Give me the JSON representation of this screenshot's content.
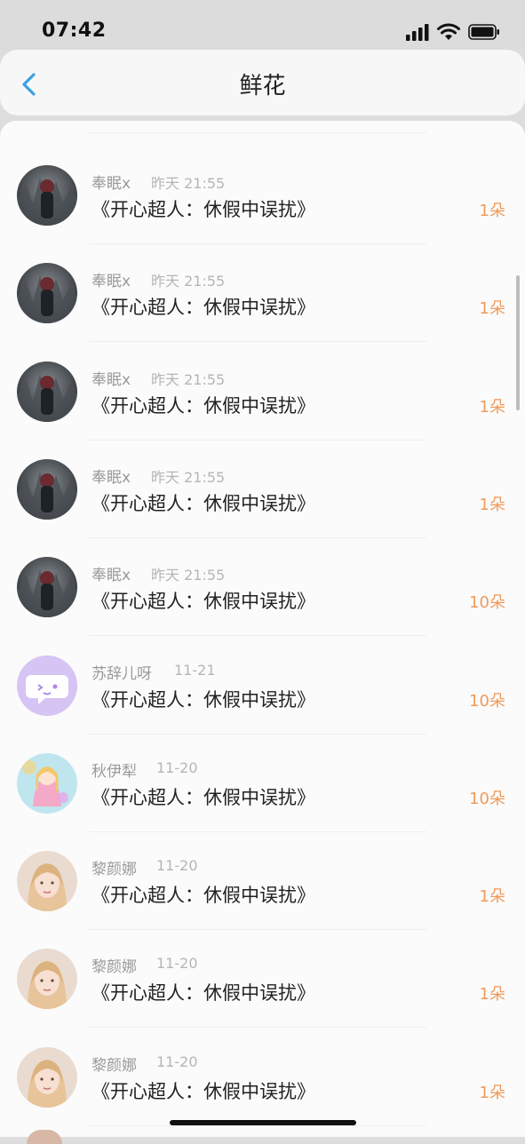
{
  "status": {
    "time": "07:42"
  },
  "header": {
    "title": "鲜花"
  },
  "icons": {
    "back": "chevron-left-icon",
    "signal": "signal-icon",
    "wifi": "wifi-icon",
    "battery": "battery-icon"
  },
  "colors": {
    "accent": "#3aa0e6",
    "count": "#f09a5a",
    "name": "#9a9a9a",
    "time": "#b5b5b5"
  },
  "items": [
    {
      "name": "奉眠x",
      "time": "昨天 21:55",
      "title": "《开心超人：休假中误扰》",
      "count": "1朵",
      "avatar": "dark-photo"
    },
    {
      "name": "奉眠x",
      "time": "昨天 21:55",
      "title": "《开心超人：休假中误扰》",
      "count": "1朵",
      "avatar": "dark-photo"
    },
    {
      "name": "奉眠x",
      "time": "昨天 21:55",
      "title": "《开心超人：休假中误扰》",
      "count": "1朵",
      "avatar": "dark-photo"
    },
    {
      "name": "奉眠x",
      "time": "昨天 21:55",
      "title": "《开心超人：休假中误扰》",
      "count": "1朵",
      "avatar": "dark-photo"
    },
    {
      "name": "奉眠x",
      "time": "昨天 21:55",
      "title": "《开心超人：休假中误扰》",
      "count": "10朵",
      "avatar": "dark-photo"
    },
    {
      "name": "苏辞儿呀",
      "time": "11-21",
      "title": "《开心超人：休假中误扰》",
      "count": "10朵",
      "avatar": "purple-chat"
    },
    {
      "name": "秋伊犁",
      "time": "11-20",
      "title": "《开心超人：休假中误扰》",
      "count": "10朵",
      "avatar": "anime-girl"
    },
    {
      "name": "黎颜娜",
      "time": "11-20",
      "title": "《开心超人：休假中误扰》",
      "count": "1朵",
      "avatar": "portrait-girl"
    },
    {
      "name": "黎颜娜",
      "time": "11-20",
      "title": "《开心超人：休假中误扰》",
      "count": "1朵",
      "avatar": "portrait-girl"
    },
    {
      "name": "黎颜娜",
      "time": "11-20",
      "title": "《开心超人：休假中误扰》",
      "count": "1朵",
      "avatar": "portrait-girl"
    }
  ]
}
